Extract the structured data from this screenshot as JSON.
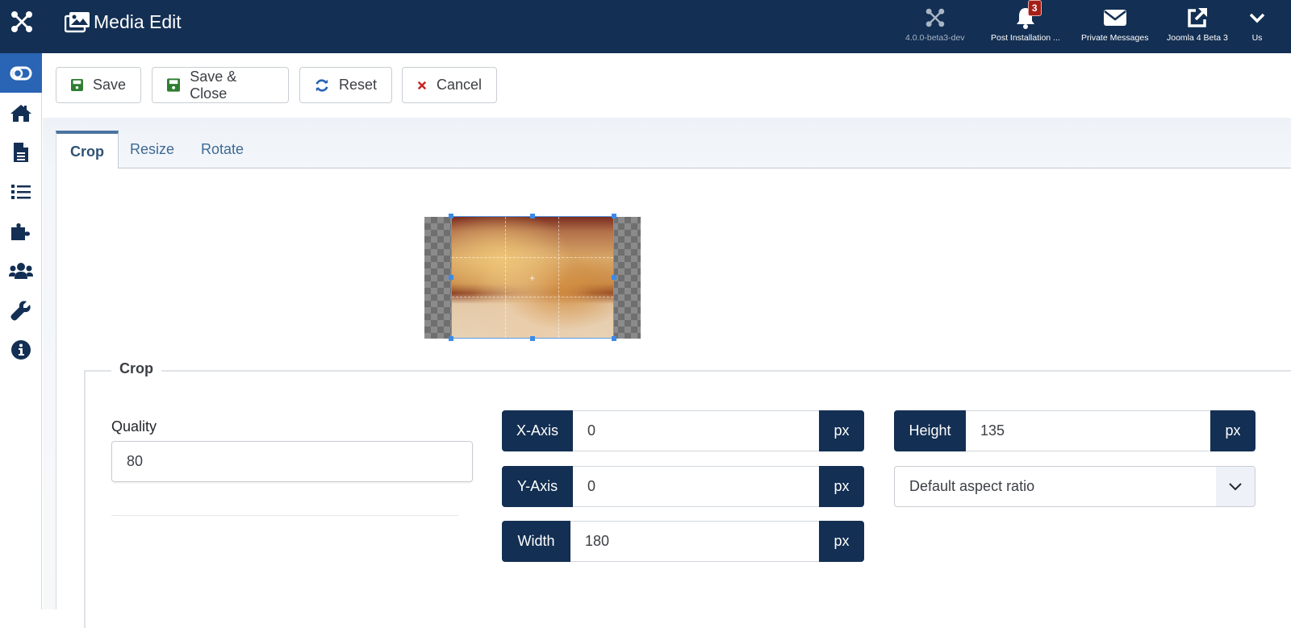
{
  "header": {
    "title": "Media Edit",
    "items": [
      {
        "label": "4.0.0-beta3-dev",
        "icon": "joomla-icon"
      },
      {
        "label": "Post Installation ...",
        "icon": "bell-icon",
        "badge": "3"
      },
      {
        "label": "Private Messages",
        "icon": "envelope-icon"
      },
      {
        "label": "Joomla 4 Beta 3",
        "icon": "external-link-icon"
      },
      {
        "label": "Us",
        "icon": "chevron-down-icon"
      }
    ]
  },
  "sidebar": {
    "items": [
      {
        "name": "toggle-menu",
        "icon": "toggle-icon"
      },
      {
        "name": "home",
        "icon": "home-icon"
      },
      {
        "name": "content",
        "icon": "file-icon"
      },
      {
        "name": "menus",
        "icon": "list-icon"
      },
      {
        "name": "components",
        "icon": "puzzle-icon"
      },
      {
        "name": "users",
        "icon": "users-icon"
      },
      {
        "name": "system",
        "icon": "wrench-icon"
      },
      {
        "name": "help",
        "icon": "info-icon"
      }
    ]
  },
  "toolbar": {
    "save": "Save",
    "save_close": "Save & Close",
    "reset": "Reset",
    "cancel": "Cancel"
  },
  "tabs": [
    {
      "label": "Crop",
      "active": true
    },
    {
      "label": "Resize",
      "active": false
    },
    {
      "label": "Rotate",
      "active": false
    }
  ],
  "crop": {
    "legend": "Crop",
    "quality_label": "Quality",
    "quality_value": "80",
    "x_axis_label": "X-Axis",
    "x_axis_value": "0",
    "y_axis_label": "Y-Axis",
    "y_axis_value": "0",
    "width_label": "Width",
    "width_value": "180",
    "height_label": "Height",
    "height_value": "135",
    "unit": "px",
    "aspect_ratio_selected": "Default aspect ratio"
  },
  "colors": {
    "header_bg": "#132f53",
    "sidebar_active": "#2a64b4",
    "save_icon": "#2f7d32",
    "reset_icon": "#2a64b4",
    "cancel_icon": "#c52827",
    "badge": "#a51f18"
  }
}
